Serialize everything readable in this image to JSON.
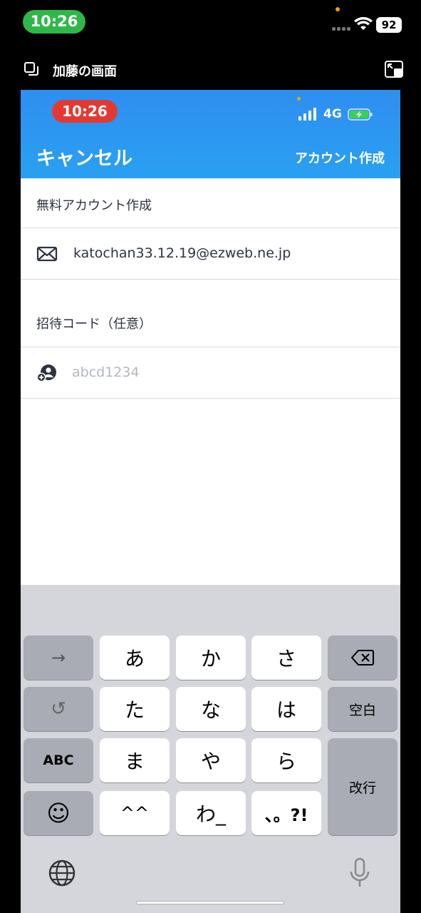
{
  "outer_status": {
    "time": "10:26",
    "battery": "92"
  },
  "share": {
    "title": "加藤の画面"
  },
  "inner_status": {
    "time": "10:26",
    "network": "4G"
  },
  "nav": {
    "cancel_label": "キャンセル",
    "create_label": "アカウント作成"
  },
  "form": {
    "section_title": "無料アカウント作成",
    "email": "katochan33.12.19@ezweb.ne.jp",
    "invite_label": "招待コード（任意）",
    "invite_placeholder": "abcd1234"
  },
  "keyboard": {
    "next_key": "→",
    "undo_key": "↺",
    "abc_key": "ABC",
    "emoji_key": "☺",
    "kana": [
      "あ",
      "か",
      "さ",
      "た",
      "な",
      "は",
      "ま",
      "や",
      "ら",
      "^^",
      "わ_",
      "、。?!"
    ],
    "space_key": "空白",
    "return_key": "改行"
  },
  "icons": {
    "email": "mail-icon",
    "invite": "user-add-icon",
    "backspace": "backspace-icon",
    "globe": "globe-icon",
    "mic": "microphone-icon"
  },
  "colors": {
    "header_blue": "#2f8ef0",
    "outer_time_green": "#2fb84a",
    "inner_time_red": "#e23a33",
    "keyboard_bg": "#d5d6dc"
  }
}
